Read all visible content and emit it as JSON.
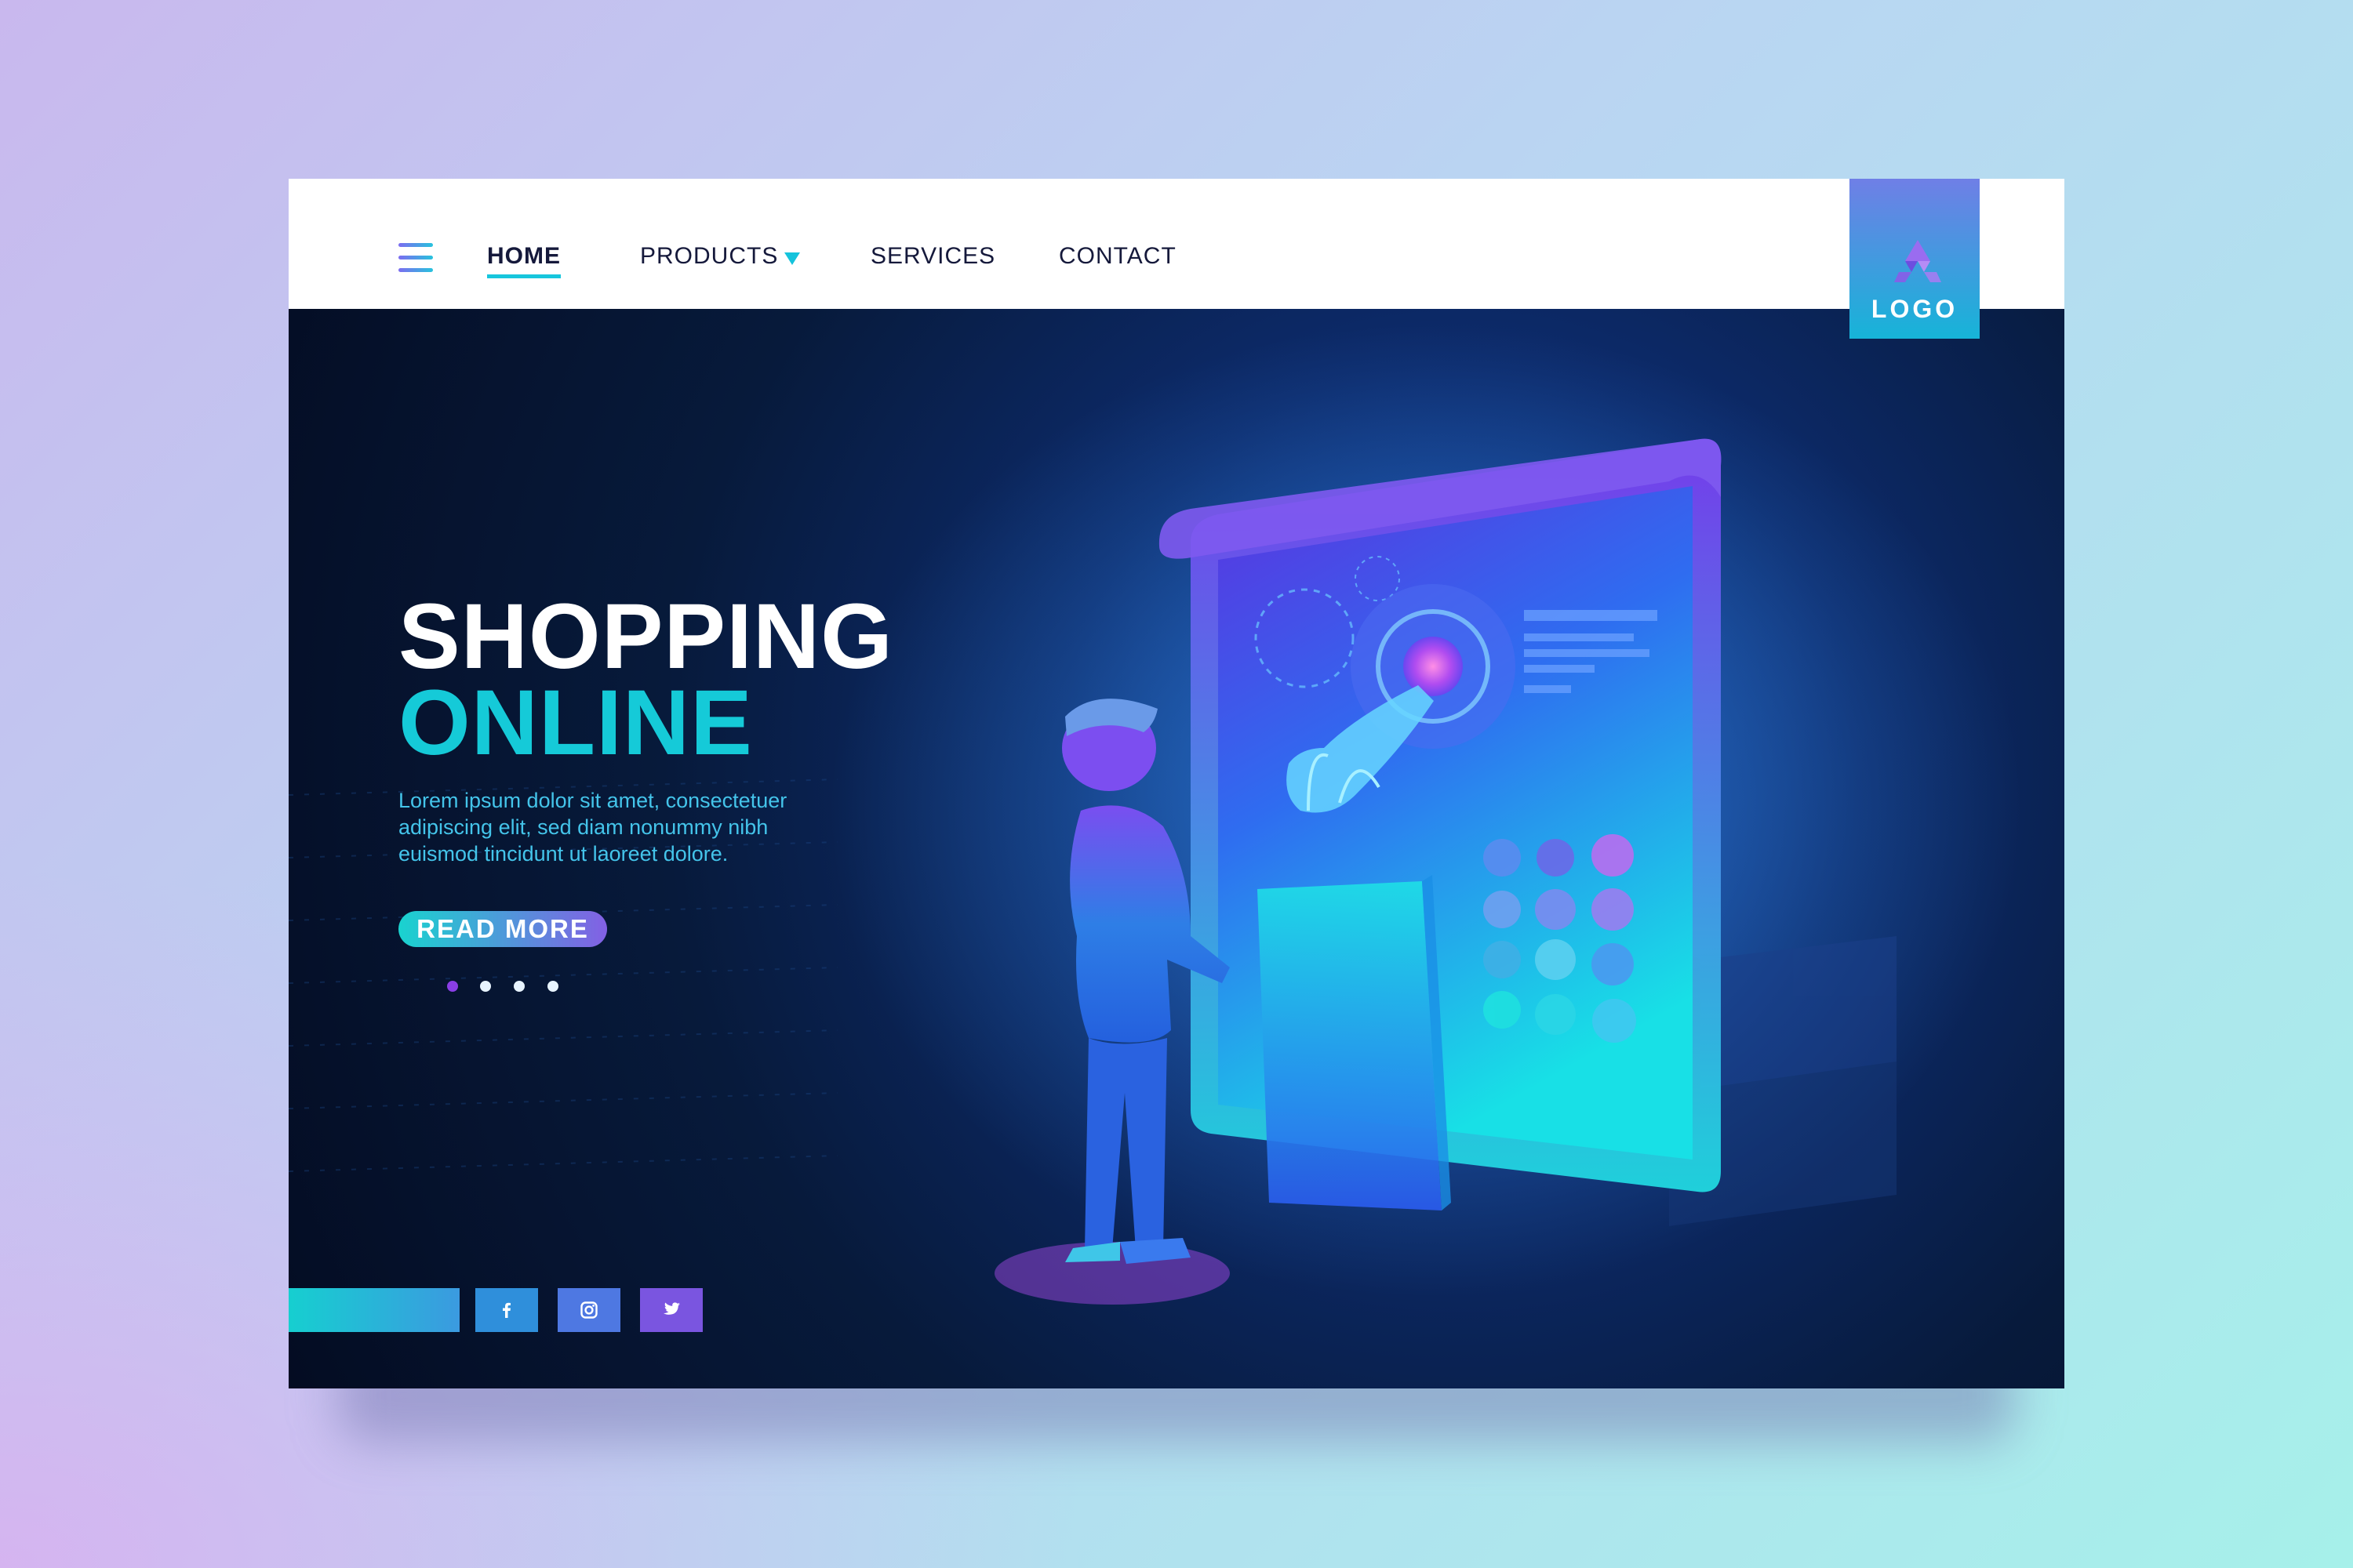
{
  "nav": {
    "items": [
      {
        "label": "HOME",
        "active": true
      },
      {
        "label": "PRODUCTS",
        "has_dropdown": true
      },
      {
        "label": "SERVICES"
      },
      {
        "label": "CONTACT"
      }
    ],
    "menu_icon": "hamburger-icon",
    "dropdown_icon": "chevron-down-icon"
  },
  "logo": {
    "text": "LOGO",
    "icon": "triangle-logo-icon"
  },
  "hero": {
    "title_line1": "SHOPPING",
    "title_line2": "ONLINE",
    "description": "Lorem ipsum dolor sit amet, consectetuer adipiscing elit, sed diam nonummy nibh euismod tincidunt ut laoreet dolore.",
    "cta_label": "READ MORE",
    "slide_count": 4,
    "active_slide": 1,
    "illustration": "person-shopping-from-tablet"
  },
  "social": [
    {
      "name": "facebook",
      "icon": "facebook-icon"
    },
    {
      "name": "instagram",
      "icon": "instagram-icon"
    },
    {
      "name": "twitter",
      "icon": "twitter-icon"
    }
  ],
  "colors": {
    "accent_cyan": "#15cad8",
    "accent_purple": "#8360e4",
    "hero_dark": "#071a3b",
    "nav_text": "#15193b"
  }
}
